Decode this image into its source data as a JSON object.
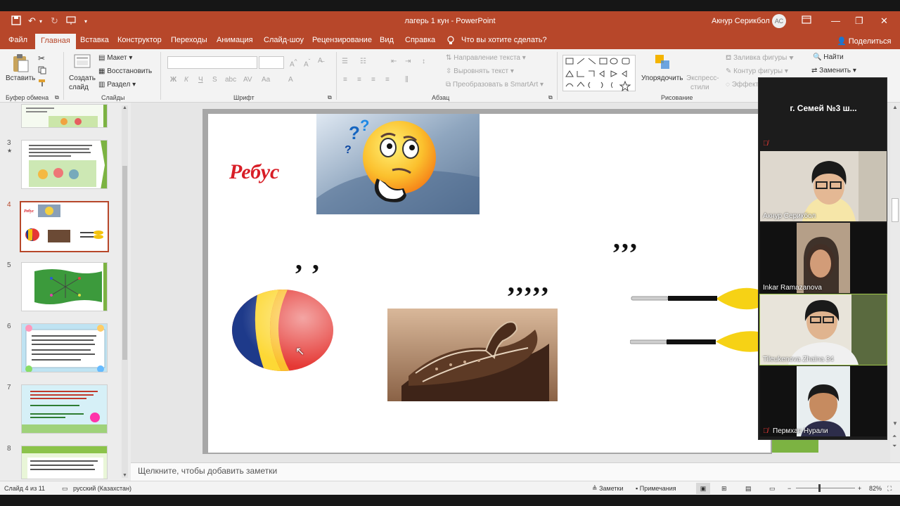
{
  "titlebar": {
    "doc_title": "лагерь 1 кун  -  PowerPoint",
    "user_name": "Акнур Серикбол",
    "user_initials": "АС"
  },
  "tabs": [
    "Файл",
    "Главная",
    "Вставка",
    "Конструктор",
    "Переходы",
    "Анимация",
    "Слайд-шоу",
    "Рецензирование",
    "Вид",
    "Справка"
  ],
  "tell_me": "Что вы хотите сделать?",
  "share": "Поделиться",
  "ribbon": {
    "clipboard": {
      "paste": "Вставить",
      "label": "Буфер обмена"
    },
    "slides": {
      "new_slide_1": "Создать",
      "new_slide_2": "слайд",
      "layout": "Макет",
      "reset": "Восстановить",
      "section": "Раздел",
      "label": "Слайды"
    },
    "font": {
      "label": "Шрифт"
    },
    "paragraph": {
      "text_dir": "Направление текста",
      "align_text": "Выровнять текст",
      "smartart": "Преобразовать в SmartArt",
      "label": "Абзац"
    },
    "drawing": {
      "arrange": "Упорядочить",
      "quick_styles_1": "Экспресс-",
      "quick_styles_2": "стили",
      "fill": "Заливка фигуры",
      "outline": "Контур фигуры",
      "effects": "Эффекты",
      "label": "Рисование"
    },
    "editing": {
      "find": "Найти",
      "replace": "Заменить"
    }
  },
  "thumbnails": [
    {
      "num": "3",
      "star": "★"
    },
    {
      "num": "4"
    },
    {
      "num": "5"
    },
    {
      "num": "6"
    },
    {
      "num": "7"
    },
    {
      "num": "8"
    }
  ],
  "slide": {
    "title": "Ребус",
    "commas_ball": ", ,",
    "commas_saddle": ",,,,,",
    "commas_oars": ",,,"
  },
  "notes_placeholder": "Щелкните, чтобы добавить заметки",
  "status": {
    "slide_count": "Слайд 4 из 11",
    "language": "русский (Казахстан)",
    "notes": "Заметки",
    "comments": "Примечания",
    "zoom": "82%"
  },
  "zoom_overlay": {
    "header": "г. Семей №3 ш...",
    "participants": [
      {
        "name": "Акнур Серикбол"
      },
      {
        "name": "Inkar Ramazanova"
      },
      {
        "name": "Tileukenova Zhaina 34"
      },
      {
        "name": "Пермхан Нурали"
      }
    ]
  },
  "colors": {
    "accent": "#b7472a",
    "rebus_red": "#d81e27",
    "active_speaker": "#9cc447"
  }
}
